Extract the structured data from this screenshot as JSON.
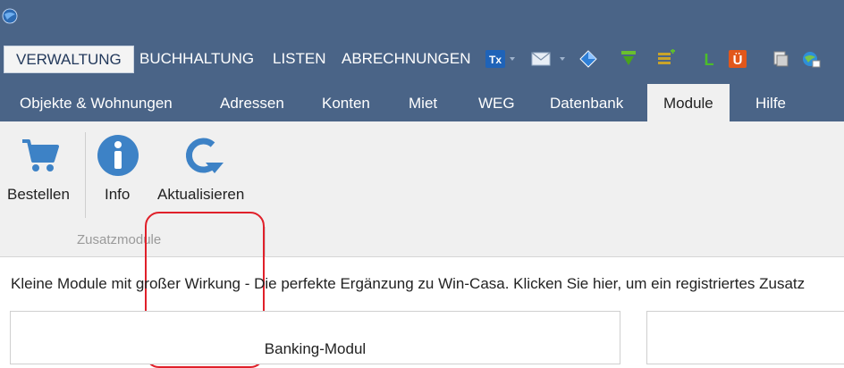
{
  "title_bar": {
    "logo_icon": "globe-app-icon"
  },
  "menu": {
    "items": [
      {
        "label": "VERWALTUNG",
        "active": true
      },
      {
        "label": "BUCHHALTUNG",
        "active": false
      },
      {
        "label": "LISTEN",
        "active": false
      },
      {
        "label": "ABRECHNUNGEN",
        "active": false
      }
    ],
    "toolbar_icons": [
      {
        "name": "tx-icon",
        "text": "Tx"
      },
      {
        "name": "mail-icon"
      },
      {
        "name": "diamond-icon"
      },
      {
        "name": "download-icon"
      },
      {
        "name": "list-icon"
      },
      {
        "name": "l-icon",
        "text": "L"
      },
      {
        "name": "u-icon",
        "text": "Ü"
      },
      {
        "name": "print-icon"
      },
      {
        "name": "web-icon"
      }
    ]
  },
  "tabs": [
    {
      "label": "Objekte & Wohnungen",
      "active": false
    },
    {
      "label": "Adressen",
      "active": false
    },
    {
      "label": "Konten",
      "active": false
    },
    {
      "label": "Miet",
      "active": false
    },
    {
      "label": "WEG",
      "active": false
    },
    {
      "label": "Datenbank",
      "active": false
    },
    {
      "label": "Module",
      "active": true
    },
    {
      "label": "Hilfe",
      "active": false
    }
  ],
  "ribbon": {
    "buttons": [
      {
        "label": "Bestellen",
        "icon": "cart-icon"
      },
      {
        "label": "Info",
        "icon": "info-icon"
      },
      {
        "label": "Aktualisieren",
        "icon": "refresh-icon"
      }
    ],
    "group_label": "Zusatzmodule"
  },
  "content": {
    "intro_text": "Kleine Module mit großer Wirkung - Die perfekte Ergänzung zu Win-Casa. Klicken Sie hier, um ein registriertes Zusatz",
    "cards": [
      {
        "title": "Banking-Modul"
      },
      {
        "title": ""
      }
    ]
  },
  "colors": {
    "header_bg": "#4a6487",
    "ribbon_bg": "#f0f0f0",
    "icon_blue": "#3d82c6",
    "highlight_red": "#e0202a"
  }
}
